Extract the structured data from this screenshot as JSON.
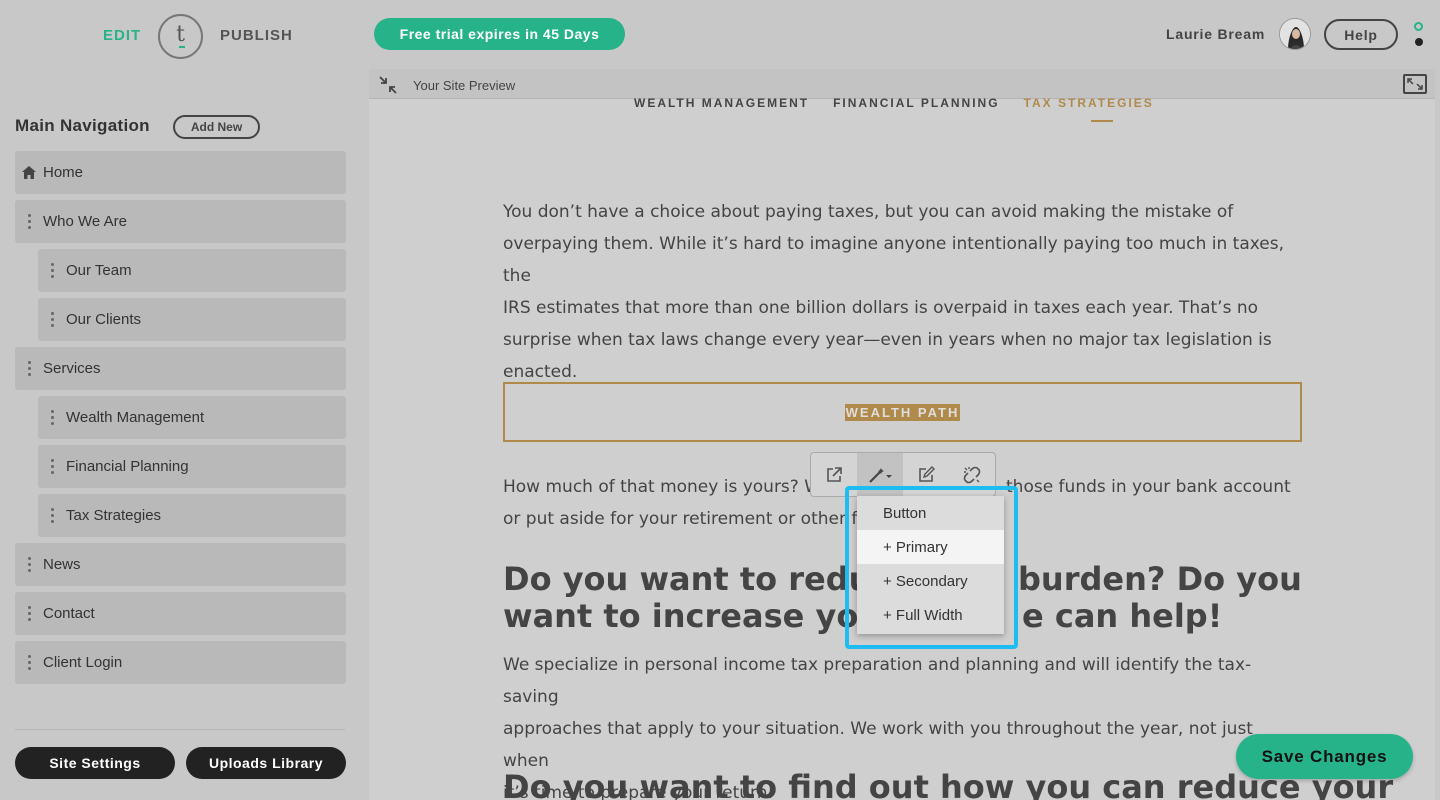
{
  "header": {
    "edit_label": "EDIT",
    "logo_letter": "t",
    "publish_label": "PUBLISH",
    "trial_text": "Free trial expires in 45 Days",
    "user_name": "Laurie Bream",
    "help_label": "Help"
  },
  "sidebar": {
    "title": "Main Navigation",
    "add_new_label": "Add New",
    "items": [
      {
        "label": "Home"
      },
      {
        "label": "Who We Are"
      },
      {
        "label": "Our Team"
      },
      {
        "label": "Our Clients"
      },
      {
        "label": "Services"
      },
      {
        "label": "Wealth Management"
      },
      {
        "label": "Financial Planning"
      },
      {
        "label": "Tax Strategies"
      },
      {
        "label": "News"
      },
      {
        "label": "Contact"
      },
      {
        "label": "Client Login"
      }
    ],
    "site_settings_label": "Site Settings",
    "uploads_library_label": "Uploads Library"
  },
  "preview": {
    "title": "Your Site Preview",
    "site_nav": [
      "WEALTH MANAGEMENT",
      "FINANCIAL PLANNING",
      "TAX STRATEGIES"
    ],
    "para1_lines": [
      "You don’t have a choice about paying taxes, but you can avoid making the mistake of",
      "overpaying them. While it’s hard to imagine anyone intentionally paying too much in taxes, the",
      "IRS estimates that more than one billion dollars is overpaid in taxes each year. That’s no",
      "surprise when tax laws change every year—even in years when no major tax legislation is",
      "enacted."
    ],
    "cta_label": "WEALTH PATH",
    "para2_line1_left": "How much of that money is yours? W",
    "para2_line1_right": "those funds in your bank account",
    "para2_line2": "or put aside for your retirement or other fi",
    "heading1_line1_left": "Do you want to reduce",
    "heading1_line1_right": "burden? Do you",
    "heading1_line2_left": "want to increase your",
    "heading1_line2_right": "e can help!",
    "para3_lines": [
      "We specialize in personal income tax preparation and planning and will identify the tax-saving",
      "approaches that apply to your situation. We work with you throughout the year, not just when",
      "it’s time to prepare your return."
    ],
    "heading2": "Do you want to find out how you can reduce your"
  },
  "button_menu": {
    "items": [
      "Button",
      "+ Primary",
      "+ Secondary",
      "+ Full Width"
    ],
    "selected_index": 1
  },
  "save_label": "Save Changes",
  "colors": {
    "accent": "#27b38a",
    "gold": "#b08a4a",
    "highlight": "#1ebcf0"
  }
}
